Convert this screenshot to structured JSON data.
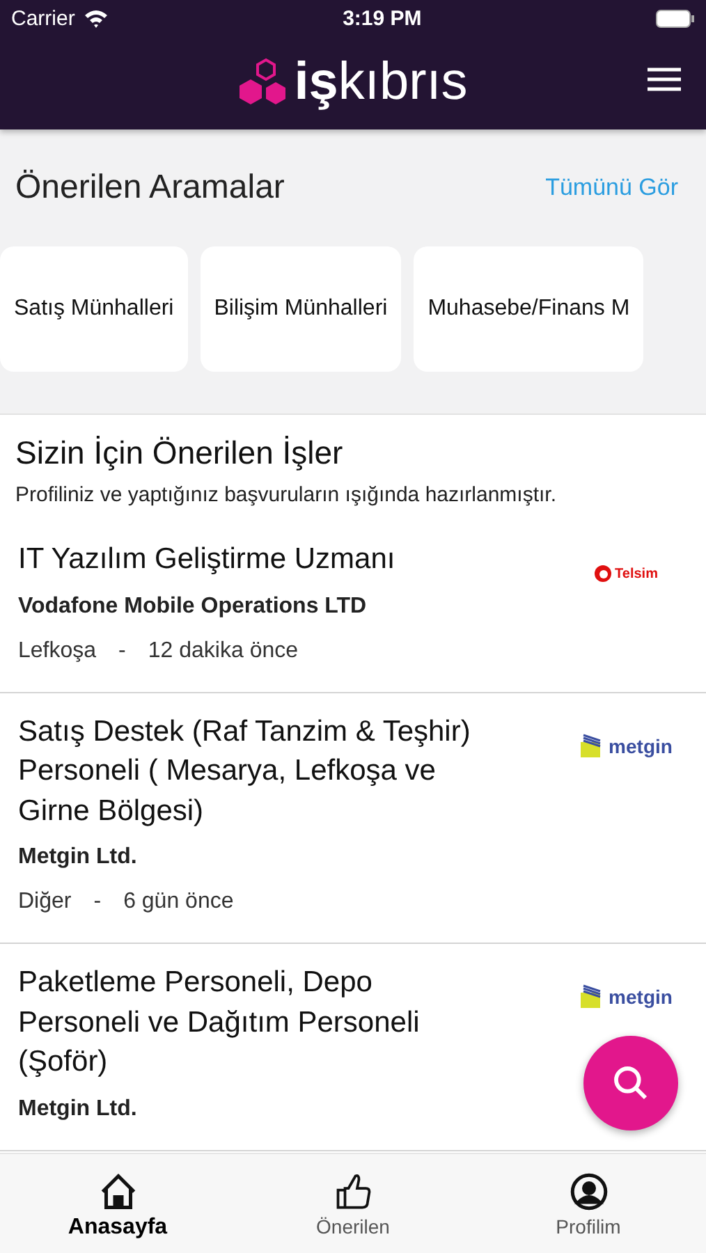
{
  "status_bar": {
    "carrier": "Carrier",
    "time": "3:19 PM"
  },
  "header": {
    "logo_bold": "iş",
    "logo_light": "kıbrıs"
  },
  "suggested_searches": {
    "title": "Önerilen Aramalar",
    "see_all": "Tümünü Gör",
    "chips": [
      "Satış Münhalleri",
      "Bilişim Münhalleri",
      "Muhasebe/Finans M"
    ]
  },
  "recommended_jobs": {
    "title": "Sizin İçin Önerilen İşler",
    "subtitle": "Profiliniz ve yaptığınız başvuruların ışığında hazırlanmıştır.",
    "jobs": [
      {
        "title": "IT Yazılım Geliştirme Uzmanı",
        "company": "Vodafone Mobile Operations LTD",
        "location": "Lefkoşa",
        "separator": "-",
        "posted": "12 dakika önce",
        "logo": {
          "kind": "telsim",
          "text": "Telsim"
        }
      },
      {
        "title": "Satış Destek (Raf Tanzim & Teşhir) Personeli ( Mesarya, Lefkoşa ve Girne Bölgesi)",
        "company": "Metgin Ltd.",
        "location": "Diğer",
        "separator": "-",
        "posted": "6 gün önce",
        "logo": {
          "kind": "metgin",
          "text": "metgin"
        }
      },
      {
        "title": "Paketleme Personeli, Depo Personeli ve Dağıtım Personeli (Şoför)",
        "company": "Metgin Ltd.",
        "logo": {
          "kind": "metgin",
          "text": "metgin"
        }
      }
    ]
  },
  "tab_bar": [
    {
      "label": "Anasayfa",
      "kind": "home",
      "selected": true
    },
    {
      "label": "Önerilen",
      "kind": "thumb",
      "selected": false
    },
    {
      "label": "Profilim",
      "kind": "user",
      "selected": false
    }
  ]
}
